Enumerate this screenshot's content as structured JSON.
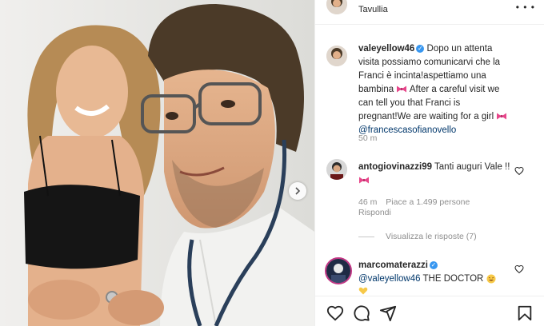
{
  "post": {
    "location": "Tavullia",
    "caption": {
      "username": "valeyellow46",
      "text_it": "Dopo un attenta visita possiamo comunicarvi che la Franci è incinta!aspettiamo una bambina",
      "text_en": "After a careful visit we can tell you that Franci is pregnant!We are waiting for a girl",
      "mention": "@francescasofianovello",
      "time": "50 m"
    },
    "comments": [
      {
        "username": "antogiovinazzi99",
        "text": "Tanti auguri Vale !!",
        "time": "46 m",
        "likes": "Piace a 1.499 persone",
        "reply": "Rispondi",
        "view_replies": "Visualizza le risposte (7)"
      },
      {
        "username": "marcomaterazzi",
        "mention": "@valeyellow46",
        "text": "THE DOCTOR"
      }
    ]
  },
  "icons": {
    "like": "heart-icon",
    "comment": "comment-icon",
    "share": "share-icon",
    "save": "bookmark-icon",
    "next": "chevron-right-icon",
    "verified": "verified-badge-icon",
    "ribbon": "pink-ribbon-emoji",
    "laugh": "laughing-emoji"
  },
  "colors": {
    "verified": "#3897f0",
    "mention": "#00376b",
    "muted": "#8e8e8e",
    "ribbon": "#e7468a"
  }
}
